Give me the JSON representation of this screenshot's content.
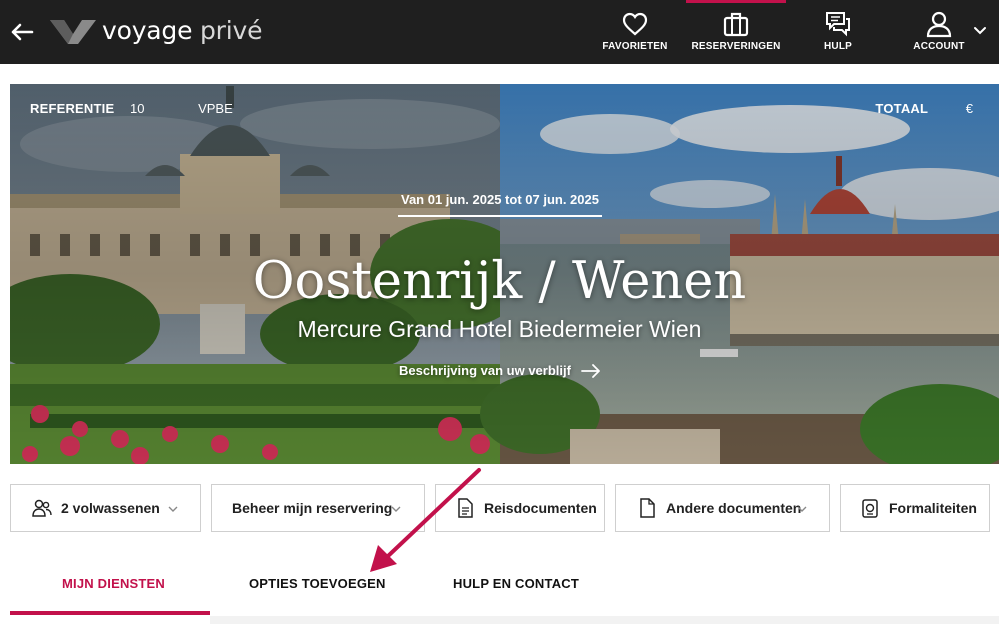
{
  "header": {
    "brand_part1": "voyage",
    "brand_part2": "privé",
    "nav": [
      {
        "label": "FAVORIETEN",
        "icon": "heart-icon"
      },
      {
        "label": "RESERVERINGEN",
        "icon": "suitcase-icon",
        "active": true
      },
      {
        "label": "HULP",
        "icon": "chat-help-icon"
      },
      {
        "label": "ACCOUNT",
        "icon": "user-icon"
      }
    ],
    "accent": "#c2114b",
    "bg": "#1f1f1f"
  },
  "hero": {
    "reference_label": "REFERENTIE",
    "reference_value_start": "10",
    "reference_value_end": "VPBE",
    "total_label": "TOTAAL",
    "total_currency": "€",
    "dates": "Van 01 jun. 2025 tot 07 jun. 2025",
    "destination": "Oostenrijk / Wenen",
    "hotel": "Mercure Grand Hotel Biedermeier Wien",
    "description_link": "Beschrijving van uw verblijf"
  },
  "actions": [
    {
      "label": "2 volwassenen",
      "icon": "users-icon",
      "has_dropdown": true
    },
    {
      "label": "Beheer mijn reservering",
      "has_dropdown": true
    },
    {
      "label": "Reisdocumenten",
      "icon": "document-icon",
      "has_dropdown": false
    },
    {
      "label": "Andere documenten",
      "icon": "file-icon",
      "has_dropdown": true
    },
    {
      "label": "Formaliteiten",
      "icon": "passport-icon",
      "has_dropdown": false
    }
  ],
  "tabs": [
    {
      "label": "MIJN DIENSTEN",
      "active": true
    },
    {
      "label": "OPTIES TOEVOEGEN",
      "active": false
    },
    {
      "label": "HULP EN CONTACT",
      "active": false
    }
  ]
}
